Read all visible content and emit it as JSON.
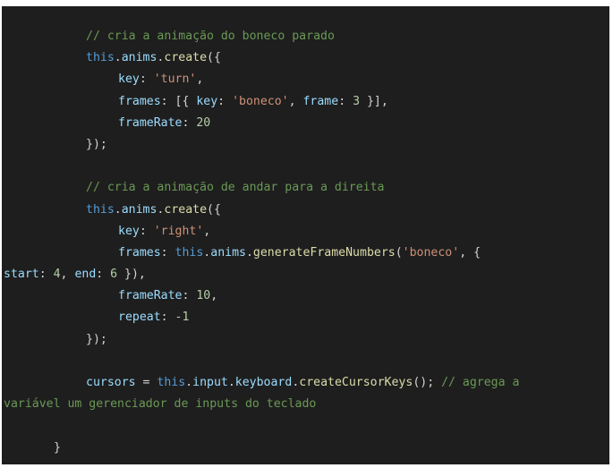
{
  "code": {
    "comment_idle": "// cria a animação do boneco parado",
    "this": "this",
    "anims": "anims",
    "create": "create",
    "key": "key",
    "frames": "frames",
    "frameRate": "frameRate",
    "repeat": "repeat",
    "turn_str": "'turn'",
    "boneco_str": "'boneco'",
    "frame": "frame",
    "frame_num": "3",
    "rate_20": "20",
    "comment_right": "// cria a animação de andar para a direita",
    "right_str": "'right'",
    "generateFrameNumbers": "generateFrameNumbers",
    "start": "start",
    "start_num": "4",
    "end": "end",
    "end_num": "6",
    "rate_10": "10",
    "repeat_val": "-1",
    "cursors": "cursors",
    "input": "input",
    "keyboard": "keyboard",
    "createCursorKeys": "createCursorKeys",
    "comment_cursors_a": "// agrega a",
    "comment_cursors_b": "variável um gerenciador de inputs do teclado"
  }
}
